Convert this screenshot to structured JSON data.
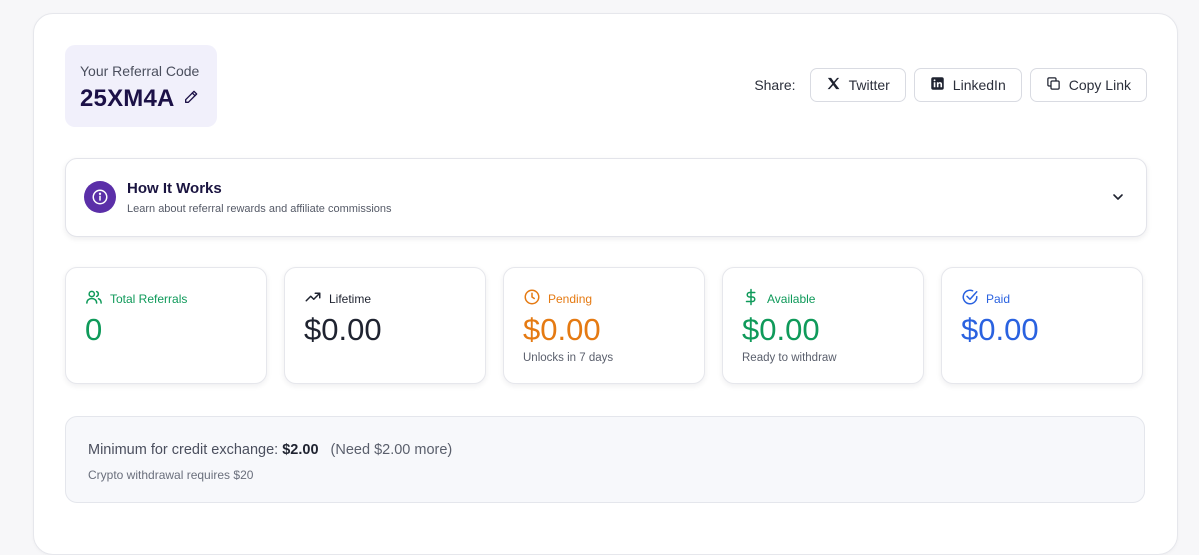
{
  "referral": {
    "label": "Your Referral Code",
    "code": "25XM4A"
  },
  "share": {
    "label": "Share:",
    "buttons": [
      {
        "label": "Twitter",
        "icon": "x-logo-icon"
      },
      {
        "label": "LinkedIn",
        "icon": "linkedin-icon"
      },
      {
        "label": "Copy Link",
        "icon": "copy-icon"
      }
    ]
  },
  "how_it_works": {
    "title": "How It Works",
    "subtitle": "Learn about referral rewards and affiliate commissions",
    "icon": "info-icon"
  },
  "stats": [
    {
      "label": "Total Referrals",
      "value": "0",
      "note": "",
      "color": "#0f9a5a",
      "icon": "users-icon"
    },
    {
      "label": "Lifetime",
      "value": "$0.00",
      "note": "",
      "color": "#1f2330",
      "icon": "trending-up-icon"
    },
    {
      "label": "Pending",
      "value": "$0.00",
      "note": "Unlocks in 7 days",
      "color": "#e57a12",
      "icon": "clock-icon"
    },
    {
      "label": "Available",
      "value": "$0.00",
      "note": "Ready to withdraw",
      "color": "#0f9a5a",
      "icon": "dollar-icon"
    },
    {
      "label": "Paid",
      "value": "$0.00",
      "note": "",
      "color": "#2a62e0",
      "icon": "check-circle-icon"
    }
  ],
  "minimum": {
    "prefix": "Minimum for credit exchange:",
    "amount": "$2.00",
    "need": "(Need $2.00 more)",
    "crypto_note": "Crypto withdrawal requires $20"
  },
  "colors": {
    "accent_purple": "#5b2fa8",
    "code_text": "#1c1147",
    "ref_box_bg": "#f1f0fb"
  }
}
